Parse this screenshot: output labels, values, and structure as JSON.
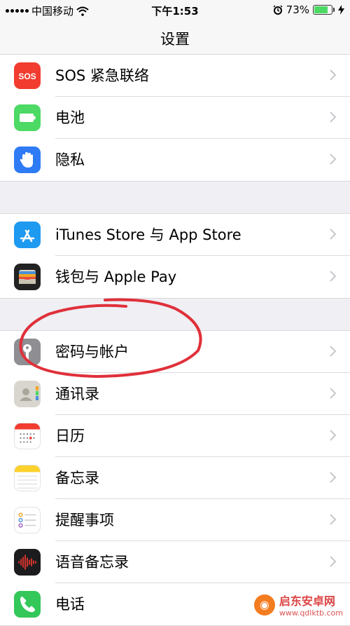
{
  "status_bar": {
    "carrier": "中国移动",
    "time": "下午1:53",
    "battery": "73%",
    "battery_level": 0.73
  },
  "nav": {
    "title": "设置"
  },
  "groups": [
    {
      "rows": [
        {
          "icon": "sos-icon",
          "label": "SOS 紧急联络",
          "color": "#f23c30"
        },
        {
          "icon": "battery-icon",
          "label": "电池",
          "color": "#4cd964"
        },
        {
          "icon": "privacy-hand-icon",
          "label": "隐私",
          "color": "#2f7bf5"
        }
      ]
    },
    {
      "rows": [
        {
          "icon": "app-store-icon",
          "label": "iTunes Store 与 App Store",
          "color": "#1e9af1"
        },
        {
          "icon": "wallet-icon",
          "label": "钱包与 Apple Pay",
          "color": "#222222"
        }
      ]
    },
    {
      "rows": [
        {
          "icon": "key-icon",
          "label": "密码与帐户",
          "color": "#8e8e93"
        },
        {
          "icon": "contacts-icon",
          "label": "通讯录",
          "color": "#d8d6cf"
        },
        {
          "icon": "calendar-icon",
          "label": "日历",
          "color": "#ffffff"
        },
        {
          "icon": "notes-icon",
          "label": "备忘录",
          "color": "#ffffff"
        },
        {
          "icon": "reminders-icon",
          "label": "提醒事项",
          "color": "#ffffff"
        },
        {
          "icon": "voice-memos-icon",
          "label": "语音备忘录",
          "color": "#1c1c1e"
        },
        {
          "icon": "phone-icon",
          "label": "电话",
          "color": "#34c759"
        }
      ]
    }
  ],
  "annotation": {
    "color": "#e0303a"
  },
  "watermark": {
    "name": "启东安卓网",
    "url": "www.qdlktb.com"
  }
}
